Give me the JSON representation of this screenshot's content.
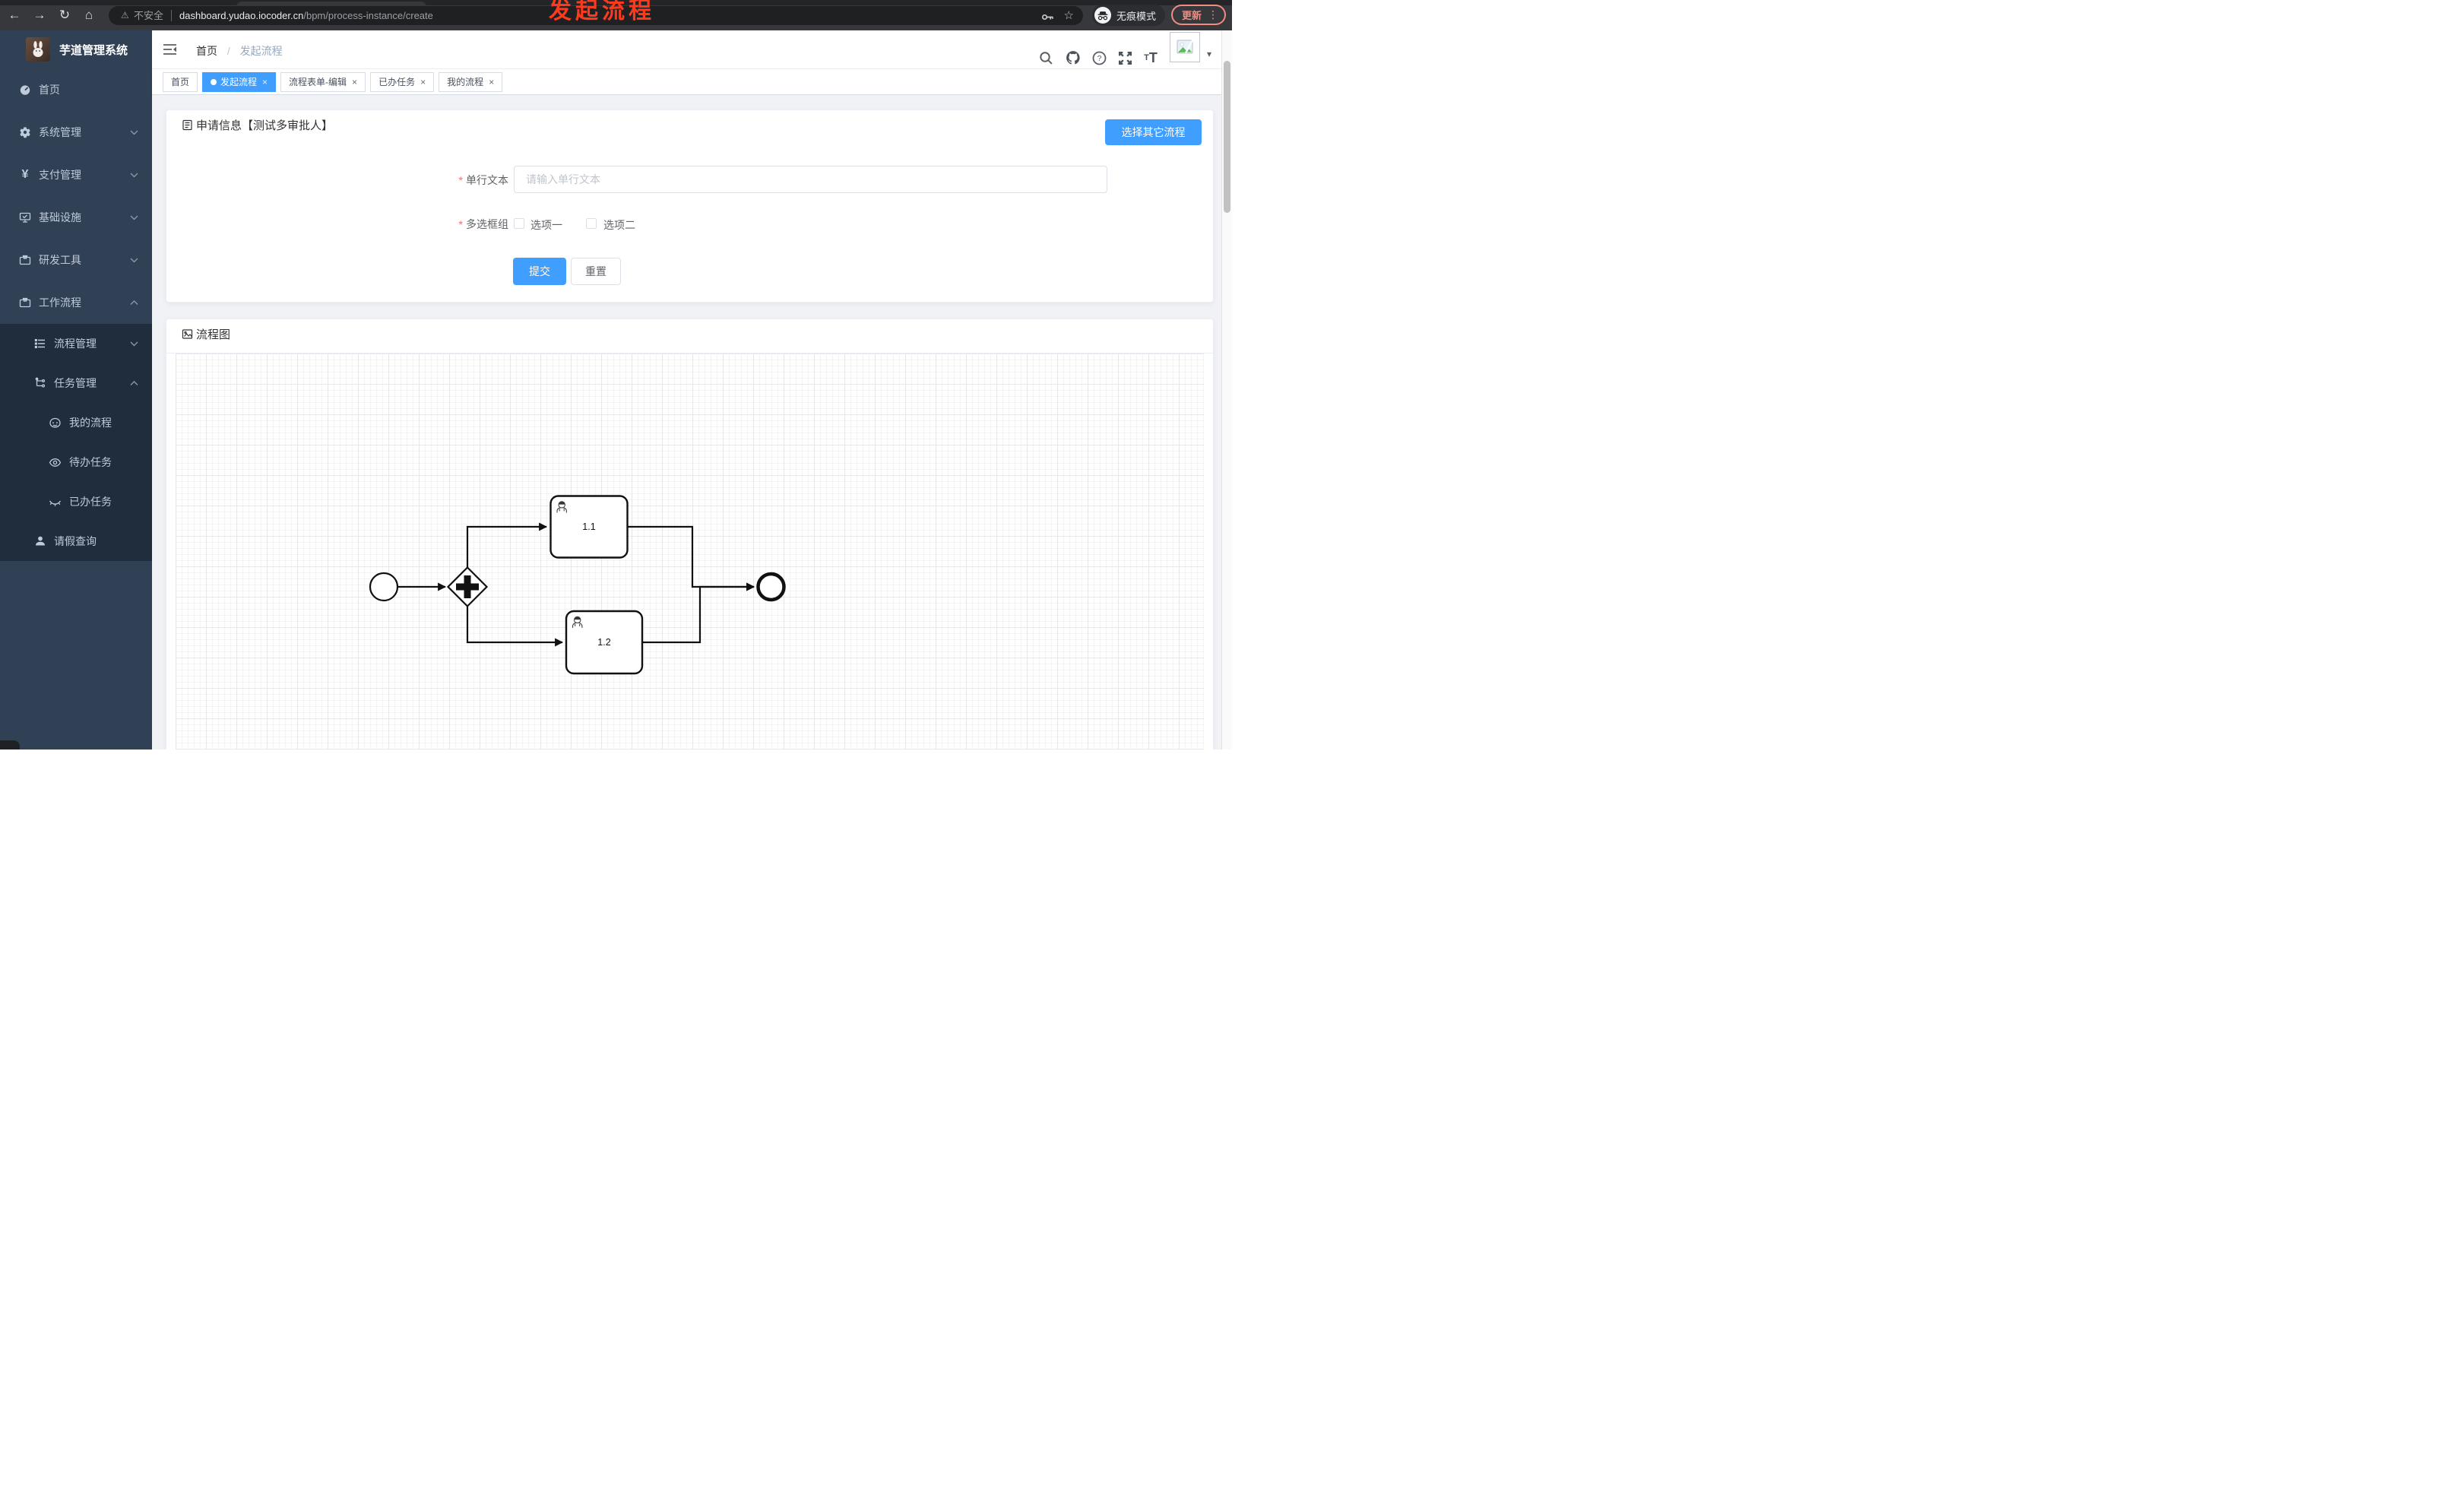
{
  "browser": {
    "security_label": "不安全",
    "url_host": "dashboard.yudao.iocoder.cn",
    "url_path": "/bpm/process-instance/create",
    "incognito_label": "无痕模式",
    "update_label": "更新"
  },
  "icons": {
    "back": "←",
    "forward": "→",
    "reload": "↻",
    "home": "⌂",
    "warning": "⚠",
    "star": "☆",
    "dots": "⋮",
    "caret": "▾",
    "close": "×",
    "slash": "/",
    "font_small": "T",
    "font_big": "T"
  },
  "sidebar": {
    "title": "芋道管理系统",
    "items": [
      {
        "label": "首页"
      },
      {
        "label": "系统管理"
      },
      {
        "label": "支付管理"
      },
      {
        "label": "基础设施"
      },
      {
        "label": "研发工具"
      },
      {
        "label": "工作流程"
      },
      {
        "label": "流程管理"
      },
      {
        "label": "任务管理"
      },
      {
        "label": "我的流程"
      },
      {
        "label": "待办任务"
      },
      {
        "label": "已办任务"
      },
      {
        "label": "请假查询"
      }
    ]
  },
  "navbar": {
    "breadcrumb": [
      "首页",
      "发起流程"
    ]
  },
  "annotation": {
    "text": "发起流程",
    "color": "#fb3a1e"
  },
  "tabs": [
    {
      "label": "首页"
    },
    {
      "label": "发起流程"
    },
    {
      "label": "流程表单-编辑"
    },
    {
      "label": "已办任务"
    },
    {
      "label": "我的流程"
    }
  ],
  "form_card": {
    "title": "申请信息【测试多审批人】",
    "choose_button": "选择其它流程",
    "fields": [
      {
        "label": "单行文本",
        "required": true,
        "placeholder": "请输入单行文本",
        "value": ""
      },
      {
        "label": "多选框组",
        "required": true,
        "options": [
          "选项一",
          "选项二"
        ],
        "checked": [
          false,
          false
        ]
      }
    ],
    "submit_label": "提交",
    "reset_label": "重置"
  },
  "diagram_card": {
    "title": "流程图",
    "bpmn": {
      "start": "start-event",
      "gateway": "parallel-gateway",
      "tasks": [
        {
          "label": "1.1"
        },
        {
          "label": "1.2"
        }
      ],
      "end": "end-event"
    }
  },
  "colors": {
    "accent": "#409eff",
    "annotation_red": "#fb3a1e",
    "sidebar_bg": "#304156",
    "submenu_bg": "#1f2d3d",
    "update_salmon": "#f28b82"
  }
}
